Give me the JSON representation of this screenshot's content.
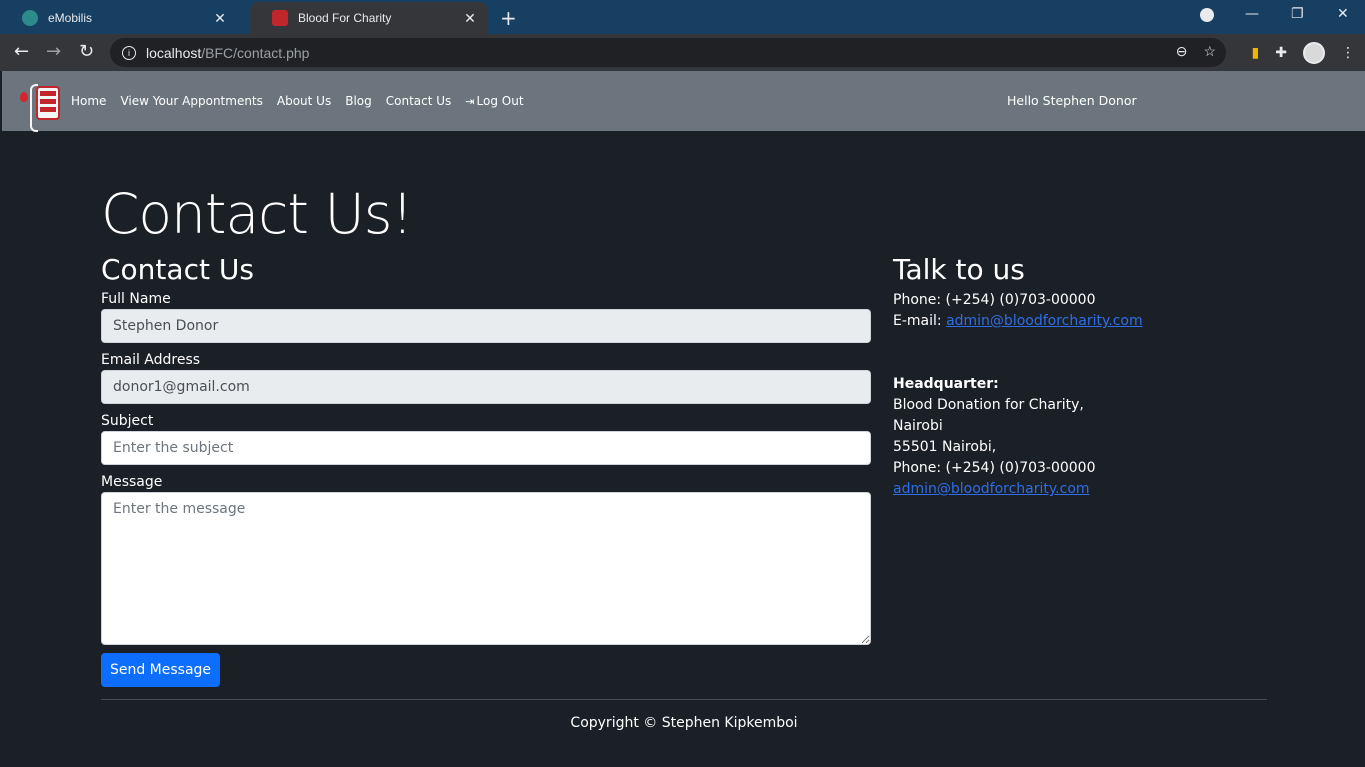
{
  "browser": {
    "tabs": [
      {
        "title": "eMobilis",
        "active": false,
        "favicon_color": "#2e8b8b"
      },
      {
        "title": "Blood For Charity",
        "active": true,
        "favicon_color": "#c0262c"
      }
    ],
    "url_host": "localhost",
    "url_path": "/BFC/contact.php"
  },
  "nav": {
    "links": [
      {
        "label": "Home"
      },
      {
        "label": "View Your Appontments"
      },
      {
        "label": "About Us"
      },
      {
        "label": "Blog"
      },
      {
        "label": "Contact Us"
      }
    ],
    "logout_label": "Log Out",
    "greeting": "Hello Stephen Donor"
  },
  "page": {
    "title": "Contact Us!"
  },
  "form": {
    "heading": "Contact Us",
    "full_name_label": "Full Name",
    "full_name_value": "Stephen Donor",
    "email_label": "Email Address",
    "email_value": "donor1@gmail.com",
    "subject_label": "Subject",
    "subject_placeholder": "Enter the subject",
    "message_label": "Message",
    "message_placeholder": "Enter the message",
    "submit_label": "Send Message"
  },
  "contact_info": {
    "heading": "Talk to us",
    "phone_line": "Phone: (+254) (0)703-00000",
    "email_prefix": "E-mail: ",
    "email": "admin@bloodforcharity.com",
    "hq_label": "Headquarter:",
    "hq_lines": [
      "Blood Donation for Charity,",
      "Nairobi",
      "55501 Nairobi,",
      "Phone: (+254) (0)703-00000"
    ],
    "hq_email": "admin@bloodforcharity.com"
  },
  "footer": {
    "copyright": "Copyright © Stephen Kipkemboi"
  },
  "colors": {
    "page_bg": "#1b1f26",
    "navbar_bg": "#6c757d",
    "primary": "#0d6efd",
    "link": "#2f6ee6"
  }
}
